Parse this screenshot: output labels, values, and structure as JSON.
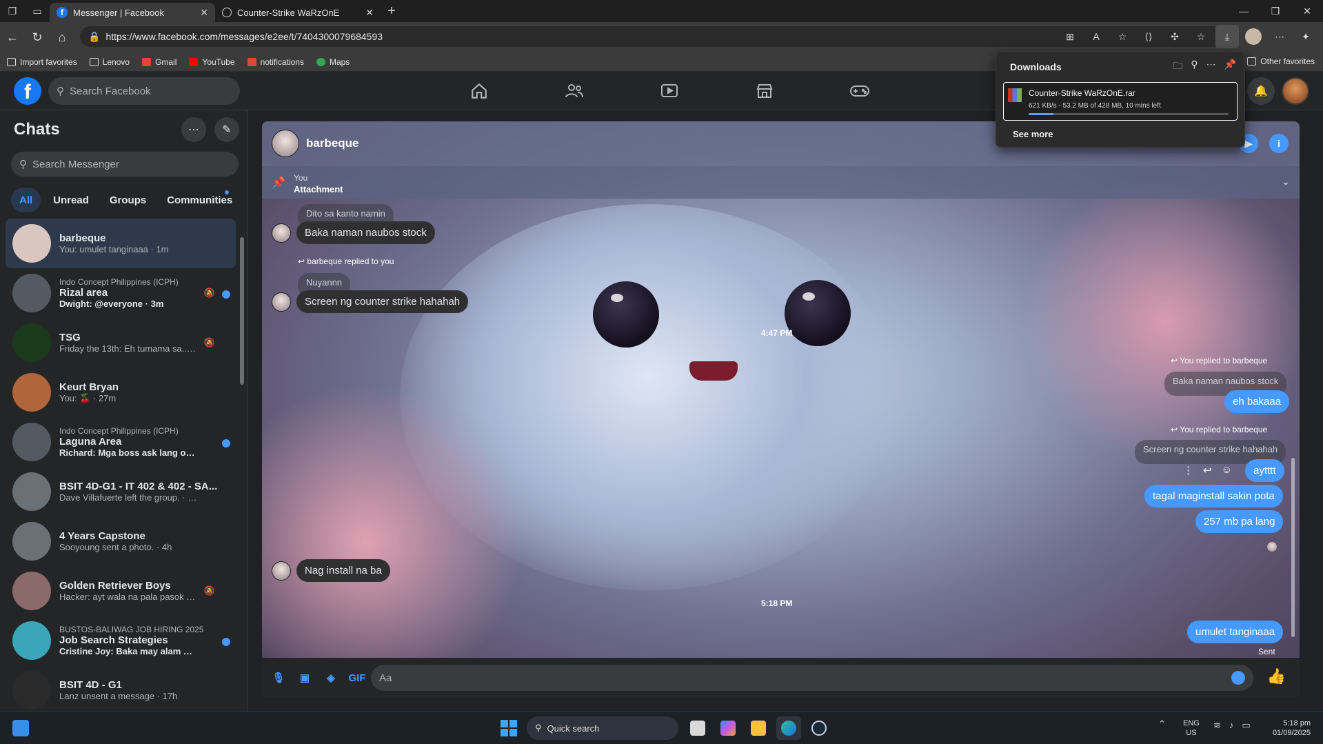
{
  "browser": {
    "tabs": [
      {
        "label": "Messenger | Facebook",
        "icon": "facebook-icon",
        "active": true
      },
      {
        "label": "Counter-Strike WaRzOnE",
        "icon": "globe-icon",
        "active": false
      }
    ],
    "url": "https://www.facebook.com/messages/e2ee/t/7404300079684593",
    "favorites": [
      "Import favorites",
      "Lenovo",
      "Gmail",
      "YouTube",
      "notifications",
      "Maps"
    ],
    "other_favorites": "Other favorites"
  },
  "downloads": {
    "title": "Downloads",
    "item_name": "Counter-Strike WaRzOnE.rar",
    "item_status": "621 KB/s - 53.2 MB of 428 MB, 10 mins left",
    "progress": 0.124,
    "see_more": "See more"
  },
  "fb": {
    "search_placeholder": "Search Facebook"
  },
  "sidebar": {
    "title": "Chats",
    "search_placeholder": "Search Messenger",
    "filters": [
      "All",
      "Unread",
      "Groups",
      "Communities"
    ],
    "chats": [
      {
        "sub": "",
        "name": "barbeque",
        "preview": "You: umulet tanginaaa · 1m",
        "unread": false,
        "muted": false,
        "selected": true,
        "color": "#d9c6c0"
      },
      {
        "sub": "Indo Concept Philippines (ICPH)",
        "name": "Rizal area",
        "preview": "Dwight: @everyone · 3m",
        "unread": true,
        "muted": true,
        "selected": false,
        "color": "#555a62"
      },
      {
        "sub": "",
        "name": "TSG",
        "preview": "Friday the 13th: Eh tumama sa... · 11m",
        "unread": false,
        "muted": true,
        "selected": false,
        "color": "#1b3a1b"
      },
      {
        "sub": "",
        "name": "Keurt Bryan",
        "preview": "You: 🍒 · 27m",
        "unread": false,
        "muted": false,
        "selected": false,
        "color": "#b0653a"
      },
      {
        "sub": "Indo Concept Philippines (ICPH)",
        "name": "Laguna Area",
        "preview": "Richard: Mga boss ask lang ok... · 43m",
        "unread": true,
        "muted": false,
        "selected": false,
        "color": "#555a62"
      },
      {
        "sub": "",
        "name": "BSIT 4D-G1 - IT 402 & 402 - SA...",
        "preview": "Dave Villafuerte left the group. · 1h",
        "unread": false,
        "muted": false,
        "selected": false,
        "color": "#6b6f76"
      },
      {
        "sub": "",
        "name": "4 Years Capstone",
        "preview": "Sooyoung sent a photo. · 4h",
        "unread": false,
        "muted": false,
        "selected": false,
        "color": "#6b6f76"
      },
      {
        "sub": "",
        "name": "Golden Retriever Boys",
        "preview": "Hacker: ayt wala na pala pasok ... · 5h",
        "unread": false,
        "muted": true,
        "selected": false,
        "color": "#8a6a6a"
      },
      {
        "sub": "BUSTOS-BALIWAG JOB HIRING 2025",
        "name": "Job Search Strategies",
        "preview": "Cristine Joy: Baka may alam po... · 12h",
        "unread": true,
        "muted": false,
        "selected": false,
        "color": "#3aa6b9"
      },
      {
        "sub": "",
        "name": "BSIT 4D - G1",
        "preview": "Lanz unsent a message · 17h",
        "unread": false,
        "muted": false,
        "selected": false,
        "color": "#2a2a2a"
      }
    ]
  },
  "conversation": {
    "name": "barbeque",
    "pinned": {
      "by": "You",
      "label": "Attachment"
    },
    "messages": {
      "quote1": "Dito sa kanto namin",
      "in1": "Baka naman naubos stock",
      "reply_note1": "barbeque replied to you",
      "quote2": "Nuyannn",
      "in2": "Screen ng counter strike hahahah",
      "time1": "4:47 PM",
      "reply_note2": "You replied to barbeque",
      "quote3": "Baka naman naubos stock",
      "out1": "eh bakaaa",
      "reply_note3": "You replied to barbeque",
      "quote4": "Screen ng counter strike hahahah",
      "out2": "aytttt",
      "out3": "tagal maginstall sakin pota",
      "out4": "257 mb pa lang",
      "in3": "Nag install na ba",
      "time2": "5:18 PM",
      "out5": "umulet tanginaaa",
      "status": "Sent"
    },
    "composer_placeholder": "Aa"
  },
  "taskbar": {
    "search": "Quick search",
    "lang_top": "ENG",
    "lang_bottom": "US",
    "time": "5:18 pm",
    "date": "01/09/2025"
  }
}
